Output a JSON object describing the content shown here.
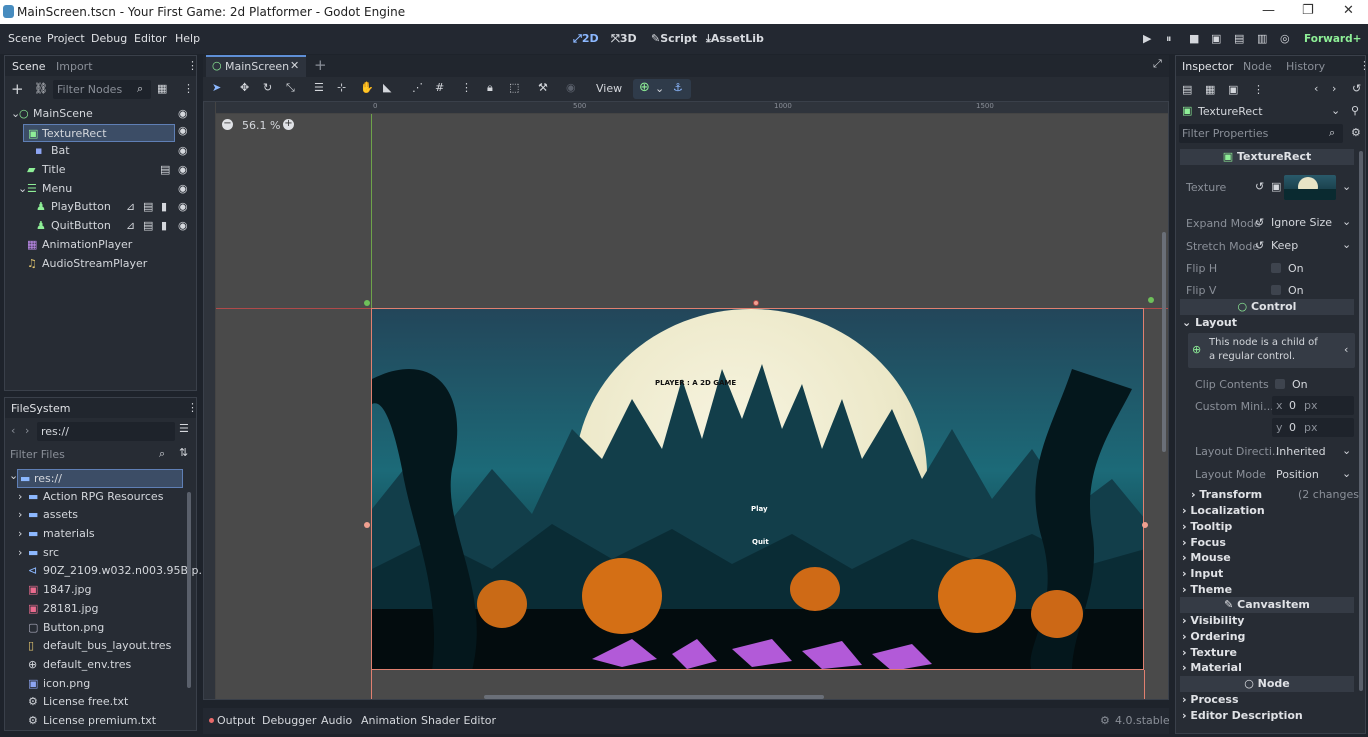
{
  "window": {
    "title": "MainScreen.tscn - Your First Game: 2d Platformer - Godot Engine",
    "min": "—",
    "max": "❐",
    "close": "✕"
  },
  "menu": [
    "Scene",
    "Project",
    "Debug",
    "Editor",
    "Help"
  ],
  "workspaces": {
    "d2": "2D",
    "d3": "3D",
    "script": "Script",
    "assetlib": "AssetLib"
  },
  "renderer": "Forward+",
  "scene_dock": {
    "tabs": [
      "Scene",
      "Import"
    ],
    "filter_placeholder": "Filter Nodes",
    "nodes": [
      {
        "label": "MainScene",
        "depth": 0,
        "color": "#8eef97",
        "icon": "circle-node"
      },
      {
        "label": "TextureRect",
        "depth": 1,
        "color": "#8eef97",
        "icon": "texture-rect",
        "selected": true
      },
      {
        "label": "Bat",
        "depth": 2,
        "color": "#8da5f3",
        "icon": "animated-sprite"
      },
      {
        "label": "Title",
        "depth": 1,
        "color": "#8eef97",
        "icon": "label"
      },
      {
        "label": "Menu",
        "depth": 1,
        "color": "#8eef97",
        "icon": "vbox"
      },
      {
        "label": "PlayButton",
        "depth": 2,
        "color": "#8eef97",
        "icon": "button"
      },
      {
        "label": "QuitButton",
        "depth": 2,
        "color": "#8eef97",
        "icon": "button"
      },
      {
        "label": "AnimationPlayer",
        "depth": 1,
        "color": "#c38ef1",
        "icon": "animation-player"
      },
      {
        "label": "AudioStreamPlayer",
        "depth": 1,
        "color": "#e0c36e",
        "icon": "audio"
      }
    ]
  },
  "filesystem": {
    "title": "FileSystem",
    "path": "res://",
    "filter_placeholder": "Filter Files",
    "items": [
      {
        "label": "res://",
        "type": "folder-open"
      },
      {
        "label": "Action RPG Resources",
        "type": "folder"
      },
      {
        "label": "assets",
        "type": "folder"
      },
      {
        "label": "materials",
        "type": "folder"
      },
      {
        "label": "src",
        "type": "folder"
      },
      {
        "label": "90Z_2109.w032.n003.95B.p...",
        "type": "file"
      },
      {
        "label": "1847.jpg",
        "type": "image"
      },
      {
        "label": "28181.jpg",
        "type": "image"
      },
      {
        "label": "Button.png",
        "type": "image"
      },
      {
        "label": "default_bus_layout.tres",
        "type": "resource"
      },
      {
        "label": "default_env.tres",
        "type": "env"
      },
      {
        "label": "icon.png",
        "type": "image"
      },
      {
        "label": "License free.txt",
        "type": "text"
      },
      {
        "label": "License premium.txt",
        "type": "text"
      }
    ]
  },
  "editor": {
    "tab": "MainScreen",
    "zoom": "56.1 %",
    "view_label": "View",
    "ruler": [
      "0",
      "500",
      "1000",
      "1500"
    ],
    "game_texts": {
      "title": "PLAYER : A 2D GAME",
      "play": "Play",
      "quit": "Quit"
    }
  },
  "bottom": {
    "tabs": [
      "Output",
      "Debugger",
      "Audio",
      "Animation",
      "Shader Editor"
    ],
    "version": "4.0.stable"
  },
  "inspector": {
    "tabs": [
      "Inspector",
      "Node",
      "History"
    ],
    "object": "TextureRect",
    "filter_placeholder": "Filter Properties",
    "class_header": "TextureRect",
    "props": {
      "texture": "Texture",
      "expand_mode": "Expand Mode",
      "expand_val": "Ignore Size",
      "stretch_mode": "Stretch Mode",
      "stretch_val": "Keep",
      "flip_h": "Flip H",
      "flip_v": "Flip V",
      "on": "On"
    },
    "control_header": "Control",
    "layout": "Layout",
    "note": "This node is a child of a regular control.",
    "clip": "Clip Contents",
    "custom_min": "Custom Mini...",
    "x": "x",
    "y": "y",
    "zero": "0",
    "px": "px",
    "layout_dir": "Layout Directi...",
    "layout_dir_val": "Inherited",
    "layout_mode": "Layout Mode",
    "layout_mode_val": "Position",
    "transform": "Transform",
    "changes": "(2 changes)",
    "groups": [
      "Localization",
      "Tooltip",
      "Focus",
      "Mouse",
      "Input",
      "Theme"
    ],
    "canvas_header": "CanvasItem",
    "canvas_groups": [
      "Visibility",
      "Ordering",
      "Texture",
      "Material"
    ],
    "node_header": "Node",
    "node_groups": [
      "Process",
      "Editor Description"
    ]
  }
}
